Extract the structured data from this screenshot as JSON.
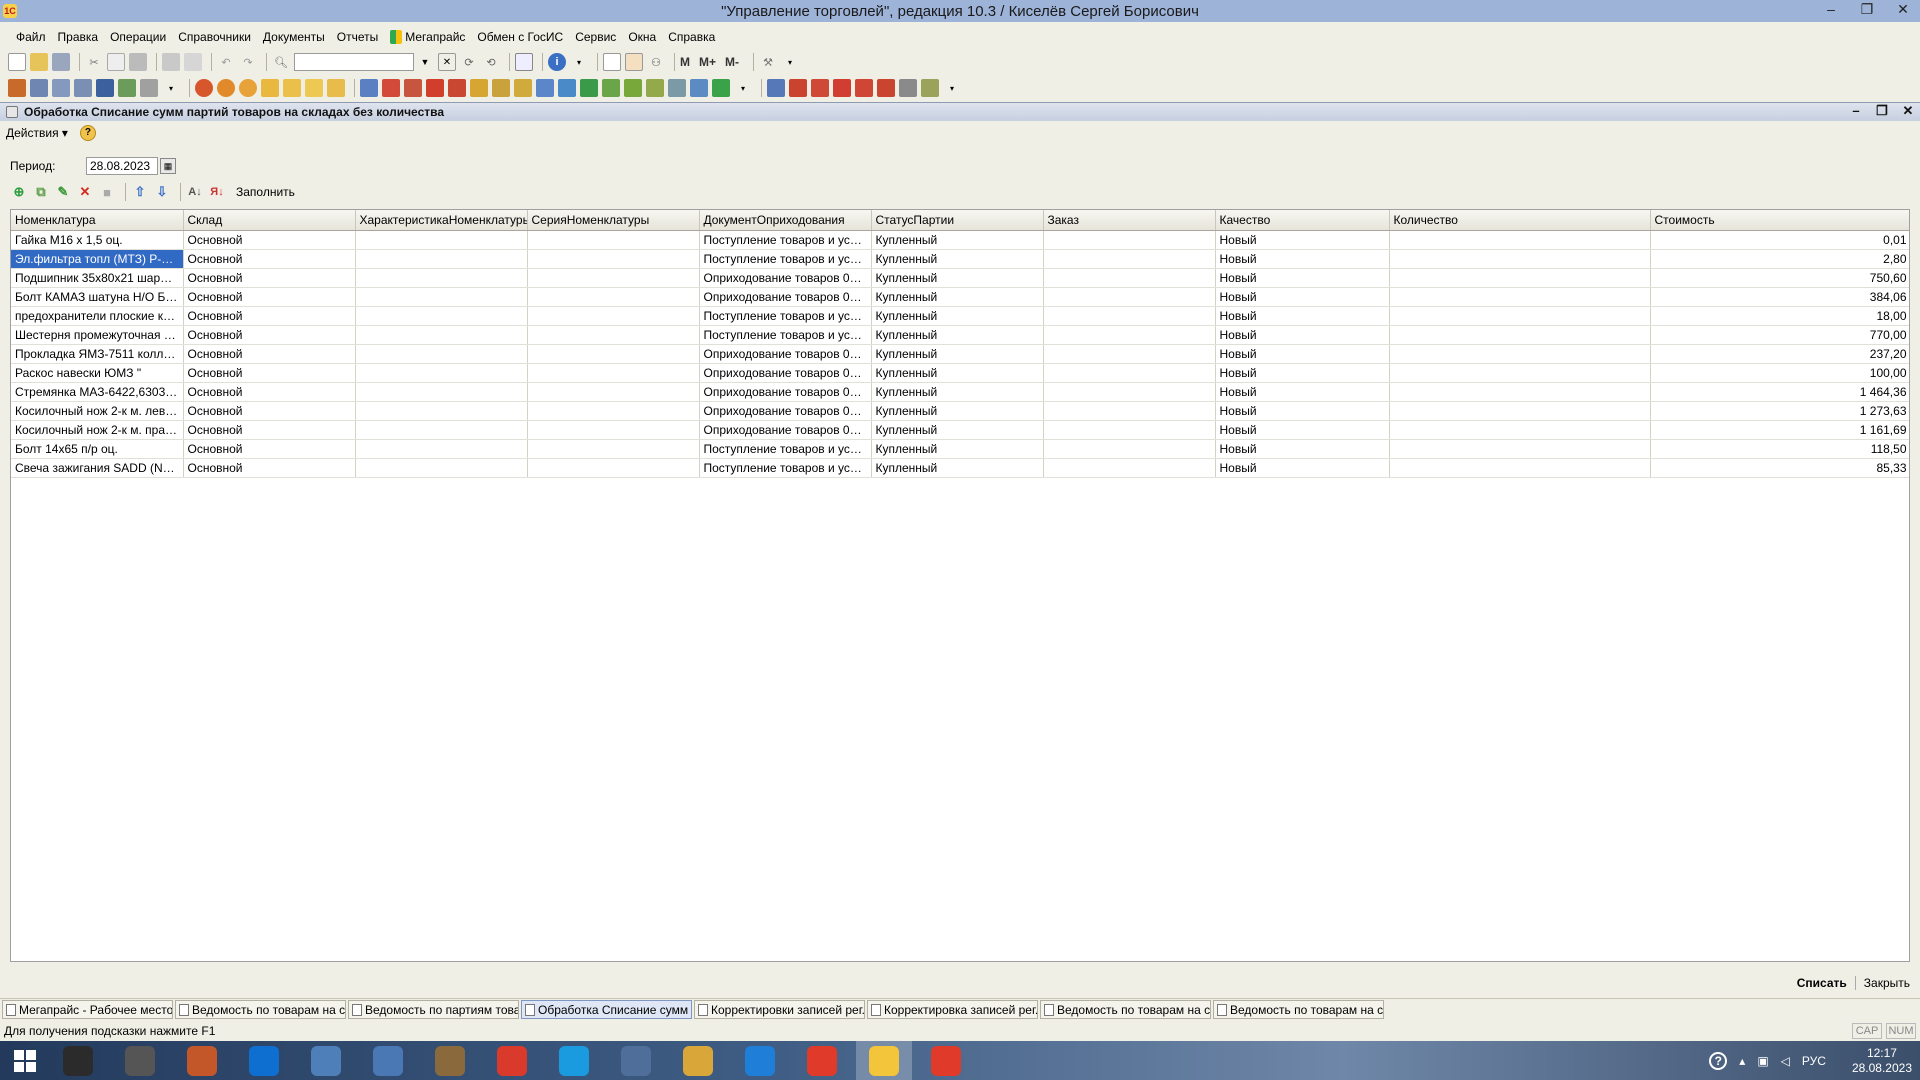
{
  "window": {
    "title": "\"Управление торговлей\", редакция 10.3 / Киселёв Сергей Борисович",
    "app_icon": "1С",
    "controls": [
      "–",
      "❐",
      "✕"
    ]
  },
  "menu": [
    "Файл",
    "Правка",
    "Операции",
    "Справочники",
    "Документы",
    "Отчеты",
    "Мегапрайс",
    "Обмен с ГосИС",
    "Сервис",
    "Окна",
    "Справка"
  ],
  "toolbar_text_buttons": {
    "m": "M",
    "mplus": "M+",
    "mminus": "M-"
  },
  "document": {
    "title": "Обработка  Списание сумм партий товаров на складах без количества",
    "actions_label": "Действия ▾",
    "help": "?",
    "period_label": "Период:",
    "period_value": "28.08.2023",
    "fill_label": "Заполнить",
    "columns": [
      "Номенклатура",
      "Склад",
      "ХарактеристикаНоменклатуры",
      "СерияНоменклатуры",
      "ДокументОприходования",
      "СтатусПартии",
      "Заказ",
      "Качество",
      "Количество",
      "Стоимость"
    ],
    "rows": [
      [
        "Гайка М16 х 1,5 оц.",
        "Основной",
        "",
        "",
        "Поступление товаров и услуг ...",
        "Купленный",
        "",
        "Новый",
        "",
        "0,01"
      ],
      [
        "Эл.фильтра топл (МТЗ) Р-532-Г...",
        "Основной",
        "",
        "",
        "Поступление товаров и услуг ...",
        "Купленный",
        "",
        "Новый",
        "",
        "2,80"
      ],
      [
        "Подшипник 35х80х21 шарик.ра...",
        "Основной",
        "",
        "",
        "Оприходование товаров 00000...",
        "Купленный",
        "",
        "Новый",
        "",
        "750,60"
      ],
      [
        "Болт КАМАЗ шатуна Н/О БЕЛ...",
        "Основной",
        "",
        "",
        "Оприходование товаров 00000...",
        "Купленный",
        "",
        "Новый",
        "",
        "384,06"
      ],
      [
        "предохранители плоские к-т 4...",
        "Основной",
        "",
        "",
        "Поступление товаров и услуг ...",
        "Купленный",
        "",
        "Новый",
        "",
        "18,00"
      ],
      [
        "Шестерня промежуточная ГРМ...",
        "Основной",
        "",
        "",
        "Поступление товаров и услуг ...",
        "Купленный",
        "",
        "Новый",
        "",
        "770,00"
      ],
      [
        "Прокладка ЯМЗ-7511 коллект...",
        "Основной",
        "",
        "",
        "Оприходование товаров 00000...",
        "Купленный",
        "",
        "Новый",
        "",
        "237,20"
      ],
      [
        "Раскос навески ЮМЗ \"",
        "Основной",
        "",
        "",
        "Оприходование товаров 00000...",
        "Купленный",
        "",
        "Новый",
        "",
        "100,00"
      ],
      [
        "Стремянка МАЗ-6422,6303 рес...",
        "Основной",
        "",
        "",
        "Оприходование товаров 00000...",
        "Купленный",
        "",
        "Новый",
        "",
        "1 464,36"
      ],
      [
        "Косилочный нож 2-к м. лев. Ор...",
        "Основной",
        "",
        "",
        "Оприходование товаров 00000...",
        "Купленный",
        "",
        "Новый",
        "",
        "1 273,63"
      ],
      [
        "Косилочный нож 2-к м. прав. О...",
        "Основной",
        "",
        "",
        "Оприходование товаров 00000...",
        "Купленный",
        "",
        "Новый",
        "",
        "1 161,69"
      ],
      [
        "Болт 14х65 п/р оц.",
        "Основной",
        "",
        "",
        "Поступление товаров и услуг ...",
        "Купленный",
        "",
        "Новый",
        "",
        "118,50"
      ],
      [
        "Свеча зажигания SADD (NK B...",
        "Основной",
        "",
        "",
        "Поступление товаров и услуг ...",
        "Купленный",
        "",
        "Новый",
        "",
        "85,33"
      ]
    ],
    "selected_row": 1,
    "write_off_label": "Списать",
    "close_label": "Закрыть"
  },
  "window_tabs": [
    {
      "label": "Мегапрайс - Рабочее место ...",
      "active": false
    },
    {
      "label": "Ведомость по товарам на с...",
      "active": false
    },
    {
      "label": "Ведомость по партиям това...",
      "active": false
    },
    {
      "label": "Обработка  Списание сумм ...",
      "active": true
    },
    {
      "label": "Корректировки записей рег...",
      "active": false
    },
    {
      "label": "Корректировка записей рег...",
      "active": false
    },
    {
      "label": "Ведомость по товарам на с...",
      "active": false
    },
    {
      "label": "Ведомость по товарам на с...",
      "active": false
    }
  ],
  "status": {
    "hint": "Для получения подсказки нажмите F1",
    "cap": "CAP",
    "num": "NUM"
  },
  "taskbar": {
    "apps": [
      {
        "icon": "app-icon",
        "color": "#2b2b2b"
      },
      {
        "icon": "pen-icon",
        "color": "#555555"
      },
      {
        "icon": "media-icon",
        "color": "#c4572a"
      },
      {
        "icon": "teamviewer-icon",
        "color": "#0e6fd1"
      },
      {
        "icon": "calculator-icon",
        "color": "#4e7fb8"
      },
      {
        "icon": "monitor-icon",
        "color": "#4a78b5"
      },
      {
        "icon": "paint-icon",
        "color": "#8a6a3c"
      },
      {
        "icon": "chrome-icon",
        "color": "#d93a2c"
      },
      {
        "icon": "skype-icon",
        "color": "#1a9be0"
      },
      {
        "icon": "network-icon",
        "color": "#4f6f9a"
      },
      {
        "icon": "explorer-icon",
        "color": "#d9a63a"
      },
      {
        "icon": "ie-icon",
        "color": "#1f7fd8"
      },
      {
        "icon": "yandex-icon",
        "color": "#e03a2a"
      },
      {
        "icon": "1c-icon",
        "color": "#f2c53a"
      },
      {
        "icon": "yandex-browser-icon",
        "color": "#e03a2a"
      }
    ],
    "lang": "РУС",
    "time": "12:17",
    "date": "28.08.2023"
  }
}
